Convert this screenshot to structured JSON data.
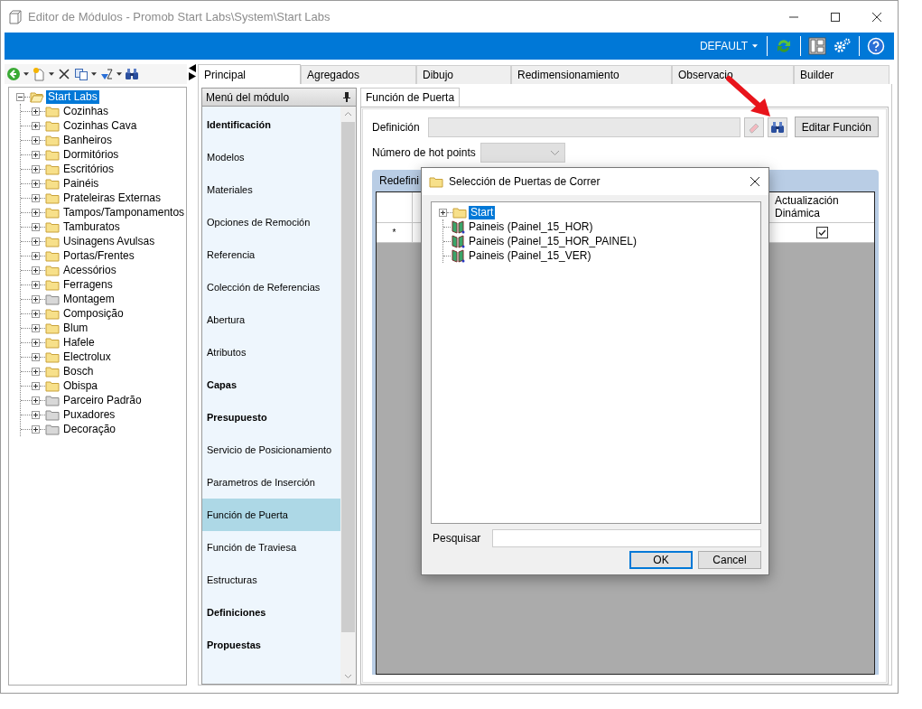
{
  "window": {
    "title": "Editor de Módulos - Promob Start Labs\\System\\Start Labs"
  },
  "toolbar": {
    "profile": "DEFAULT"
  },
  "tree": {
    "root": {
      "label": "Start Labs",
      "selected": true,
      "expanded": true,
      "children": [
        {
          "label": "Cozinhas",
          "kind": "folder"
        },
        {
          "label": "Cozinhas Cava",
          "kind": "folder"
        },
        {
          "label": "Banheiros",
          "kind": "folder"
        },
        {
          "label": "Dormitórios",
          "kind": "folder"
        },
        {
          "label": "Escritórios",
          "kind": "folder"
        },
        {
          "label": "Painéis",
          "kind": "folder"
        },
        {
          "label": "Prateleiras Externas",
          "kind": "folder"
        },
        {
          "label": "Tampos/Tamponamentos",
          "kind": "folder"
        },
        {
          "label": "Tamburatos",
          "kind": "folder"
        },
        {
          "label": "Usinagens Avulsas",
          "kind": "folder"
        },
        {
          "label": "Portas/Frentes",
          "kind": "folder"
        },
        {
          "label": "Acessórios",
          "kind": "folder"
        },
        {
          "label": "Ferragens",
          "kind": "folder"
        },
        {
          "label": "Montagem",
          "kind": "greyfolder"
        },
        {
          "label": "Composição",
          "kind": "folder"
        },
        {
          "label": "Blum",
          "kind": "folder"
        },
        {
          "label": "Hafele",
          "kind": "folder"
        },
        {
          "label": "Electrolux",
          "kind": "folder"
        },
        {
          "label": "Bosch",
          "kind": "folder"
        },
        {
          "label": "Obispa",
          "kind": "folder"
        },
        {
          "label": "Parceiro Padrão",
          "kind": "greyfolder"
        },
        {
          "label": "Puxadores",
          "kind": "greyfolder"
        },
        {
          "label": "Decoração",
          "kind": "greyfolder"
        }
      ]
    }
  },
  "tabs": [
    {
      "label": "Principal",
      "selected": true
    },
    {
      "label": "Agregados",
      "selected": false
    },
    {
      "label": "Dibujo",
      "selected": false
    },
    {
      "label": "Redimensionamiento",
      "selected": false
    },
    {
      "label": "Observacio",
      "selected": false
    },
    {
      "label": "Builder",
      "selected": false
    }
  ],
  "module_menu": {
    "title": "Menú del módulo",
    "items": [
      {
        "label": "Identificación",
        "kind": "heading",
        "selected": false
      },
      {
        "label": "Modelos",
        "kind": "item",
        "selected": false
      },
      {
        "label": "Materiales",
        "kind": "item",
        "selected": false
      },
      {
        "label": "Opciones de Remoción",
        "kind": "item",
        "selected": false
      },
      {
        "label": "Referencia",
        "kind": "item",
        "selected": false
      },
      {
        "label": "Colección de Referencias",
        "kind": "item",
        "selected": false
      },
      {
        "label": "Abertura",
        "kind": "item",
        "selected": false
      },
      {
        "label": "Atributos",
        "kind": "item",
        "selected": false
      },
      {
        "label": "Capas",
        "kind": "heading",
        "selected": false
      },
      {
        "label": "Presupuesto",
        "kind": "heading",
        "selected": false
      },
      {
        "label": "Servicio de Posicionamiento",
        "kind": "item",
        "selected": false
      },
      {
        "label": "Parametros de Inserción",
        "kind": "item",
        "selected": false
      },
      {
        "label": "Función de Puerta",
        "kind": "item",
        "selected": true
      },
      {
        "label": "Función de Traviesa",
        "kind": "item",
        "selected": false
      },
      {
        "label": "Estructuras",
        "kind": "item",
        "selected": false
      },
      {
        "label": "Definiciones",
        "kind": "heading",
        "selected": false
      },
      {
        "label": "Propuestas",
        "kind": "heading",
        "selected": false
      }
    ]
  },
  "content": {
    "subtab": {
      "label": "Función de Puerta",
      "selected": true
    },
    "definition": {
      "label": "Definición",
      "disabled": true
    },
    "edit_button": "Editar Función",
    "hot_points": {
      "label": "Número de hot points",
      "disabled": true
    },
    "group": {
      "title": "Redefini",
      "columns": [
        "Actualización Dinámica"
      ],
      "rows": [
        {
          "marker": "*",
          "dynamic_update": true
        }
      ]
    }
  },
  "dialog": {
    "title": "Selección de Puertas de Correr",
    "items": [
      {
        "label": "Start",
        "kind": "folder",
        "selected": true
      },
      {
        "label": "Paineis (Painel_15_HOR)",
        "kind": "door",
        "selected": false
      },
      {
        "label": "Paineis (Painel_15_HOR_PAINEL)",
        "kind": "door",
        "selected": false
      },
      {
        "label": "Paineis (Painel_15_VER)",
        "kind": "door",
        "selected": false
      }
    ],
    "search": {
      "label": "Pesquisar"
    },
    "buttons": [
      {
        "label": "OK",
        "default": true
      },
      {
        "label": "Cancel",
        "default": false
      }
    ]
  }
}
